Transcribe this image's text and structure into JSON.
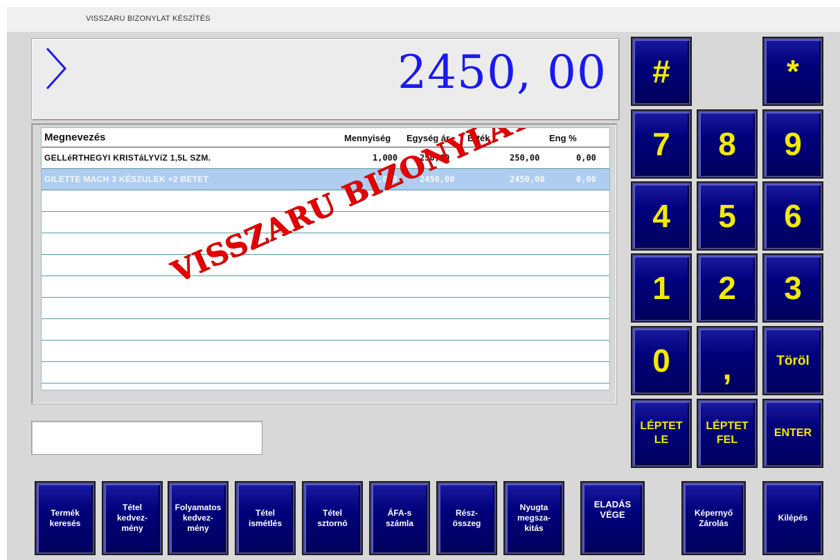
{
  "window": {
    "title": "VISSZARU BIZONYLAT KÉSZÍTÉS"
  },
  "display": {
    "prompt_icon": "chevron-right-icon",
    "amount": "2450, 00"
  },
  "table": {
    "headers": {
      "name": "Megnevezés",
      "qty": "Mennyiség",
      "price": "Egység ár",
      "value": "Érték",
      "discount": "Eng %"
    },
    "rows": [
      {
        "name": "GELLéRTHEGYI KRISTáLYVíZ 1,5L SZM.",
        "qty": "1,000",
        "price": "250,00",
        "value": "250,00",
        "discount": "0,00",
        "selected": false
      },
      {
        "name": "GILETTE MACH 3 KÉSZULEK +2 BETET",
        "qty": "1,000",
        "price": "2450,00",
        "value": "2450,00",
        "discount": "0,00",
        "selected": true
      }
    ],
    "empty_rows": 9
  },
  "watermark": "VISSZARU BIZONYLAT",
  "input": {
    "value": ""
  },
  "keypad": {
    "hash": "#",
    "star": "*",
    "k7": "7",
    "k8": "8",
    "k9": "9",
    "k4": "4",
    "k5": "5",
    "k6": "6",
    "k1": "1",
    "k2": "2",
    "k3": "3",
    "k0": "0",
    "comma": ",",
    "delete": "Töröl",
    "step_down": "LÉPTET\nLE",
    "step_up": "LÉPTET\nFEL",
    "enter": "ENTER"
  },
  "function_keys": [
    {
      "label": "Termék\nkeresés"
    },
    {
      "label": "Tétel\nkedvez-\nmény"
    },
    {
      "label": "Folyamatos\nkedvez-\nmény"
    },
    {
      "label": "Tétel\nismétlés"
    },
    {
      "label": "Tétel\nsztornó"
    },
    {
      "label": "ÁFA-s\nszámla"
    },
    {
      "label": "Rész-\nösszeg"
    },
    {
      "label": "Nyugta\nmegsza-\nkitás"
    },
    {
      "label": "ELADÁS\nVÉGE"
    },
    {
      "label": "Képernyő\nZárolás"
    },
    {
      "label": "Kilépés"
    }
  ],
  "colors": {
    "amount": "#1a1aee",
    "key_face": "#00007a",
    "key_text": "#f2ea00",
    "fkey_text": "#ffffff",
    "watermark": "#e40000",
    "selected_row": "#aecdf0"
  }
}
